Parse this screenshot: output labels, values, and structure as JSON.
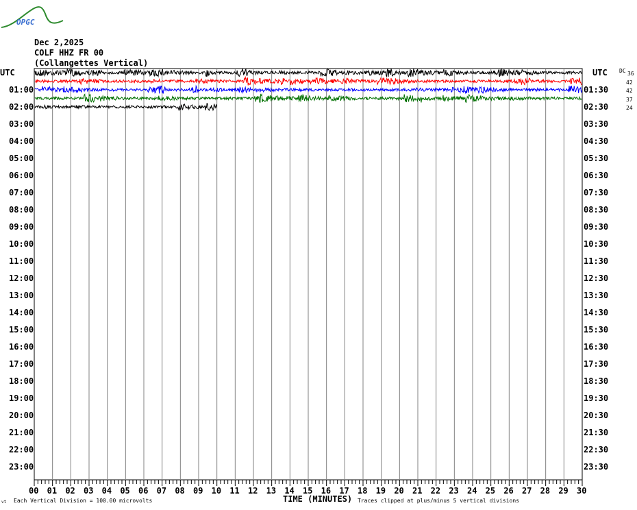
{
  "logo_text": "OPGC",
  "header": {
    "date": "Dec 2,2025",
    "station": "COLF HHZ FR 00",
    "description": "(Collangettes Vertical)"
  },
  "left_axis": {
    "title": "UTC",
    "labels": [
      "01:00",
      "02:00",
      "03:00",
      "04:00",
      "05:00",
      "06:00",
      "07:00",
      "08:00",
      "09:00",
      "10:00",
      "11:00",
      "12:00",
      "13:00",
      "14:00",
      "15:00",
      "16:00",
      "17:00",
      "18:00",
      "19:00",
      "20:00",
      "21:00",
      "22:00",
      "23:00"
    ]
  },
  "right_axis": {
    "title": "UTC",
    "labels": [
      "01:30",
      "02:30",
      "03:30",
      "04:30",
      "05:30",
      "06:30",
      "07:30",
      "08:30",
      "09:30",
      "10:30",
      "11:30",
      "12:30",
      "13:30",
      "14:30",
      "15:30",
      "16:30",
      "17:30",
      "18:30",
      "19:30",
      "20:30",
      "21:30",
      "22:30",
      "23:30"
    ]
  },
  "dc_label": "DC",
  "dc_values": [
    "36",
    "42",
    "42",
    "37",
    "24"
  ],
  "footer": {
    "xlabel": "TIME (MINUTES)",
    "scale_note": "Each Vertical Division =  100.00 microvolts",
    "clip_note": "Traces clipped at plus/minus 5 vertical divisions",
    "corner": "vt"
  },
  "chart_data": {
    "type": "line",
    "title": "COLF HHZ FR 00",
    "xlabel": "TIME (MINUTES)",
    "ylabel": "UTC",
    "xlim": [
      0,
      30
    ],
    "x_ticks": [
      "00",
      "01",
      "02",
      "03",
      "04",
      "05",
      "06",
      "07",
      "08",
      "09",
      "10",
      "11",
      "12",
      "13",
      "14",
      "15",
      "16",
      "17",
      "18",
      "19",
      "20",
      "21",
      "22",
      "23",
      "24",
      "25",
      "26",
      "27",
      "28",
      "29",
      "30"
    ],
    "rows_total": 48,
    "row_minutes": 30,
    "grid": true,
    "trace_colors": [
      "#000000",
      "#ff0000",
      "#0000ff",
      "#007000"
    ],
    "series": [
      {
        "row": 0,
        "start": "00:00",
        "end_minute": 30
      },
      {
        "row": 1,
        "start": "00:30",
        "end_minute": 30
      },
      {
        "row": 2,
        "start": "01:00",
        "end_minute": 30
      },
      {
        "row": 3,
        "start": "01:30",
        "end_minute": 30
      },
      {
        "row": 4,
        "start": "02:00",
        "end_minute": 10
      }
    ]
  }
}
